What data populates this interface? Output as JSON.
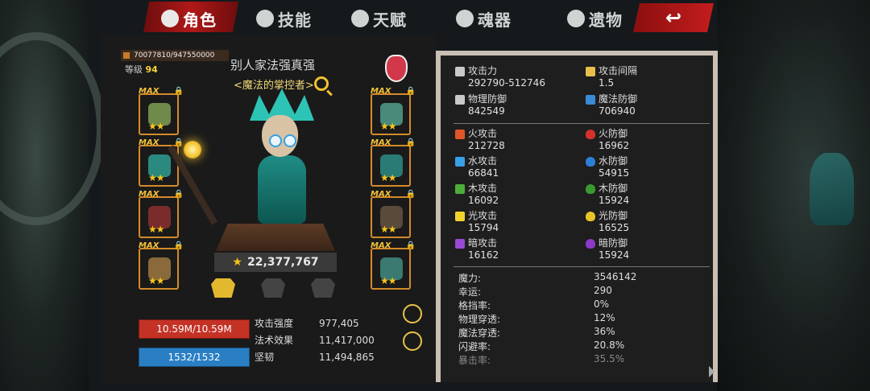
{
  "tabs": [
    {
      "label": "角色",
      "icon": "helmet-icon",
      "active": true
    },
    {
      "label": "技能",
      "icon": "skill-icon"
    },
    {
      "label": "天赋",
      "icon": "talent-icon"
    },
    {
      "label": "魂器",
      "icon": "soul-icon"
    },
    {
      "label": "遗物",
      "icon": "relic-icon"
    }
  ],
  "back_icon": "back-arrow-icon",
  "hero": {
    "xp": "70077810/947550000",
    "level_label": "等级",
    "level": "94",
    "name": "别人家法强真强",
    "title": "<魔法的掌控者>",
    "power": "22,377,767"
  },
  "equipment": {
    "max_label": "MAX",
    "stars": "★★"
  },
  "bars": {
    "hp": "10.59M/10.59M",
    "mp": "1532/1532"
  },
  "mini_stats": [
    {
      "label": "攻击强度",
      "value": "977,405"
    },
    {
      "label": "法术效果",
      "value": "11,417,000"
    },
    {
      "label": "坚韧",
      "value": "11,494,865"
    }
  ],
  "stats": {
    "attack": {
      "label": "攻击力",
      "value": "292790-512746"
    },
    "interval": {
      "label": "攻击间隔",
      "value": "1.5"
    },
    "phys_def": {
      "label": "物理防御",
      "value": "842549"
    },
    "magic_def": {
      "label": "魔法防御",
      "value": "706940"
    },
    "fire_atk": {
      "label": "火攻击",
      "value": "212728"
    },
    "fire_def": {
      "label": "火防御",
      "value": "16962"
    },
    "water_atk": {
      "label": "水攻击",
      "value": "66841"
    },
    "water_def": {
      "label": "水防御",
      "value": "54915"
    },
    "wood_atk": {
      "label": "木攻击",
      "value": "16092"
    },
    "wood_def": {
      "label": "木防御",
      "value": "15924"
    },
    "light_atk": {
      "label": "光攻击",
      "value": "15794"
    },
    "light_def": {
      "label": "光防御",
      "value": "16525"
    },
    "dark_atk": {
      "label": "暗攻击",
      "value": "16162"
    },
    "dark_def": {
      "label": "暗防御",
      "value": "15924"
    }
  },
  "misc": [
    {
      "label": "魔力:",
      "value": "3546142"
    },
    {
      "label": "幸运:",
      "value": "290"
    },
    {
      "label": "格挡率:",
      "value": "0%"
    },
    {
      "label": "物理穿透:",
      "value": "12%"
    },
    {
      "label": "魔法穿透:",
      "value": "36%"
    },
    {
      "label": "闪避率:",
      "value": "20.8%"
    },
    {
      "label": "暴击率:",
      "value": "35.5%"
    }
  ],
  "colors": {
    "accent_red": "#c41d1d",
    "gold": "#f5c518",
    "hp": "#c43226",
    "mp": "#2a7fc4"
  }
}
